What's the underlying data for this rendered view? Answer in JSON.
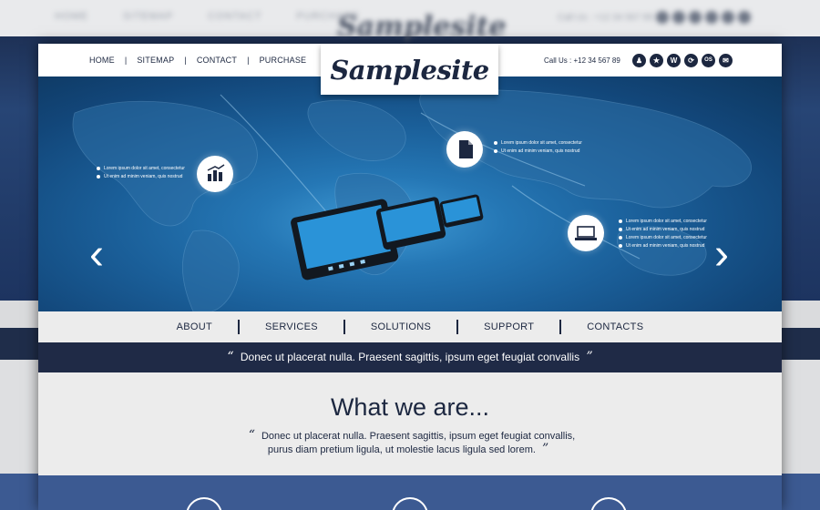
{
  "background": {
    "nav": "HOME   SITEMAP   CONTACT   PURCHASE",
    "logo": "Samplesite",
    "phone": "Call Us : +12 34 567 89"
  },
  "header": {
    "nav": [
      "HOME",
      "SITEMAP",
      "CONTACT",
      "PURCHASE"
    ],
    "logo": "Samplesite",
    "phone": "Call Us : +12 34 567 89",
    "social_icons": [
      "user-icon",
      "star-icon",
      "wordpress-icon",
      "refresh-icon",
      "os-icon",
      "mail-icon"
    ],
    "social_labels": [
      "♟",
      "★",
      "W",
      "⟳",
      "OS",
      "✉"
    ]
  },
  "hero": {
    "bullets_left": [
      "Lorem ipsum dolor sit amet, consectetur",
      "Ut enim ad minim veniam, quis nostrud"
    ],
    "bullets_top": [
      "Lorem ipsum dolor sit amet, consectetur",
      "Ut enim ad minim veniam, quis nostrud"
    ],
    "bullets_right": [
      "Lorem ipsum dolor sit amet, consectetur",
      "Ut enim ad minim veniam, quis nostrud",
      "Lorem ipsum dolor sit amet, consectetur",
      "Ut enim ad minim veniam, quis nostrud"
    ],
    "prev_arrow": "‹",
    "next_arrow": "›"
  },
  "menu": [
    "ABOUT",
    "SERVICES",
    "SOLUTIONS",
    "SUPPORT",
    "CONTACTS"
  ],
  "quote_bar": {
    "open": "“",
    "text": "Donec ut placerat nulla. Praesent sagittis, ipsum eget feugiat convallis",
    "close": "”"
  },
  "section": {
    "title": "What we are...",
    "open": "“",
    "line1": "Donec ut placerat nulla. Praesent sagittis, ipsum eget feugiat convallis,",
    "line2": "purus diam pretium ligula, ut molestie lacus ligula sed lorem.",
    "close": "”"
  },
  "colors": {
    "navy": "#1c2740",
    "hero_blue": "#1a5e98",
    "band": "#3c5a92"
  }
}
